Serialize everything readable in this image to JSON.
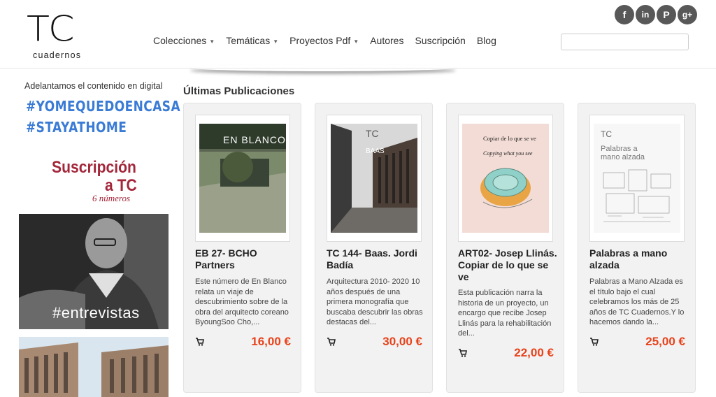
{
  "header": {
    "logo_main": "TC",
    "logo_sub": "cuadernos",
    "nav": [
      {
        "label": "Colecciones",
        "dropdown": true
      },
      {
        "label": "Temáticas",
        "dropdown": true
      },
      {
        "label": "Proyectos Pdf",
        "dropdown": true
      },
      {
        "label": "Autores",
        "dropdown": false
      },
      {
        "label": "Suscripción",
        "dropdown": false
      },
      {
        "label": "Blog",
        "dropdown": false
      }
    ],
    "search": {
      "value": "",
      "placeholder": ""
    },
    "social": [
      {
        "icon": "facebook-icon",
        "glyph": "f"
      },
      {
        "icon": "linkedin-icon",
        "glyph": "in"
      },
      {
        "icon": "pinterest-icon",
        "glyph": "P"
      },
      {
        "icon": "googleplus-icon",
        "glyph": "g+"
      }
    ]
  },
  "sidebar": {
    "promo_text": "Adelantamos el contenido en digital",
    "hashtag_1": "#YOMEQUEDOENCASA",
    "hashtag_2": "#STAYATHOME",
    "subscription_line_1": "Suscripción",
    "subscription_line_2": "a TC",
    "subscription_line_3": "6 números",
    "interviews_label": "#entrevistas"
  },
  "main": {
    "section_title": "Últimas Publicaciones",
    "products": [
      {
        "title": "EB 27- BCHO Partners",
        "description": "Este número de En Blanco relata un viaje de descubrimiento sobre de la obra del arquitecto coreano ByoungSoo Cho,...",
        "price": "16,00 €",
        "cover_text": "EN BLANCO"
      },
      {
        "title": "TC 144- Baas. Jordi Badía",
        "description": "Arquitectura 2010- 2020 10 años después de una primera monografía que buscaba descubrir las obras destacas del...",
        "price": "30,00 €",
        "cover_text": "TC",
        "cover_sub": "BAAS"
      },
      {
        "title": "ART02- Josep Llinás. Copiar de lo que se ve",
        "description": "Esta publicación narra la historia de un proyecto, un encargo que recibe Josep Llinás para la rehabilitación del...",
        "price": "22,00 €",
        "cover_text": "Copiar de lo que se ve",
        "cover_sub": "Copying what you see"
      },
      {
        "title": "Palabras a mano alzada",
        "description": "Palabras a Mano Alzada es el título bajo el cual celebramos los más de 25 años de TC Cuadernos.Y lo hacemos dando la...",
        "price": "25,00 €",
        "cover_text": "TC",
        "cover_sub": "Palabras a mano alzada"
      }
    ]
  },
  "colors": {
    "price": "#e8431b",
    "hashtag": "#3a7bd5",
    "subscription": "#a3263a",
    "social_bg": "#585858"
  }
}
